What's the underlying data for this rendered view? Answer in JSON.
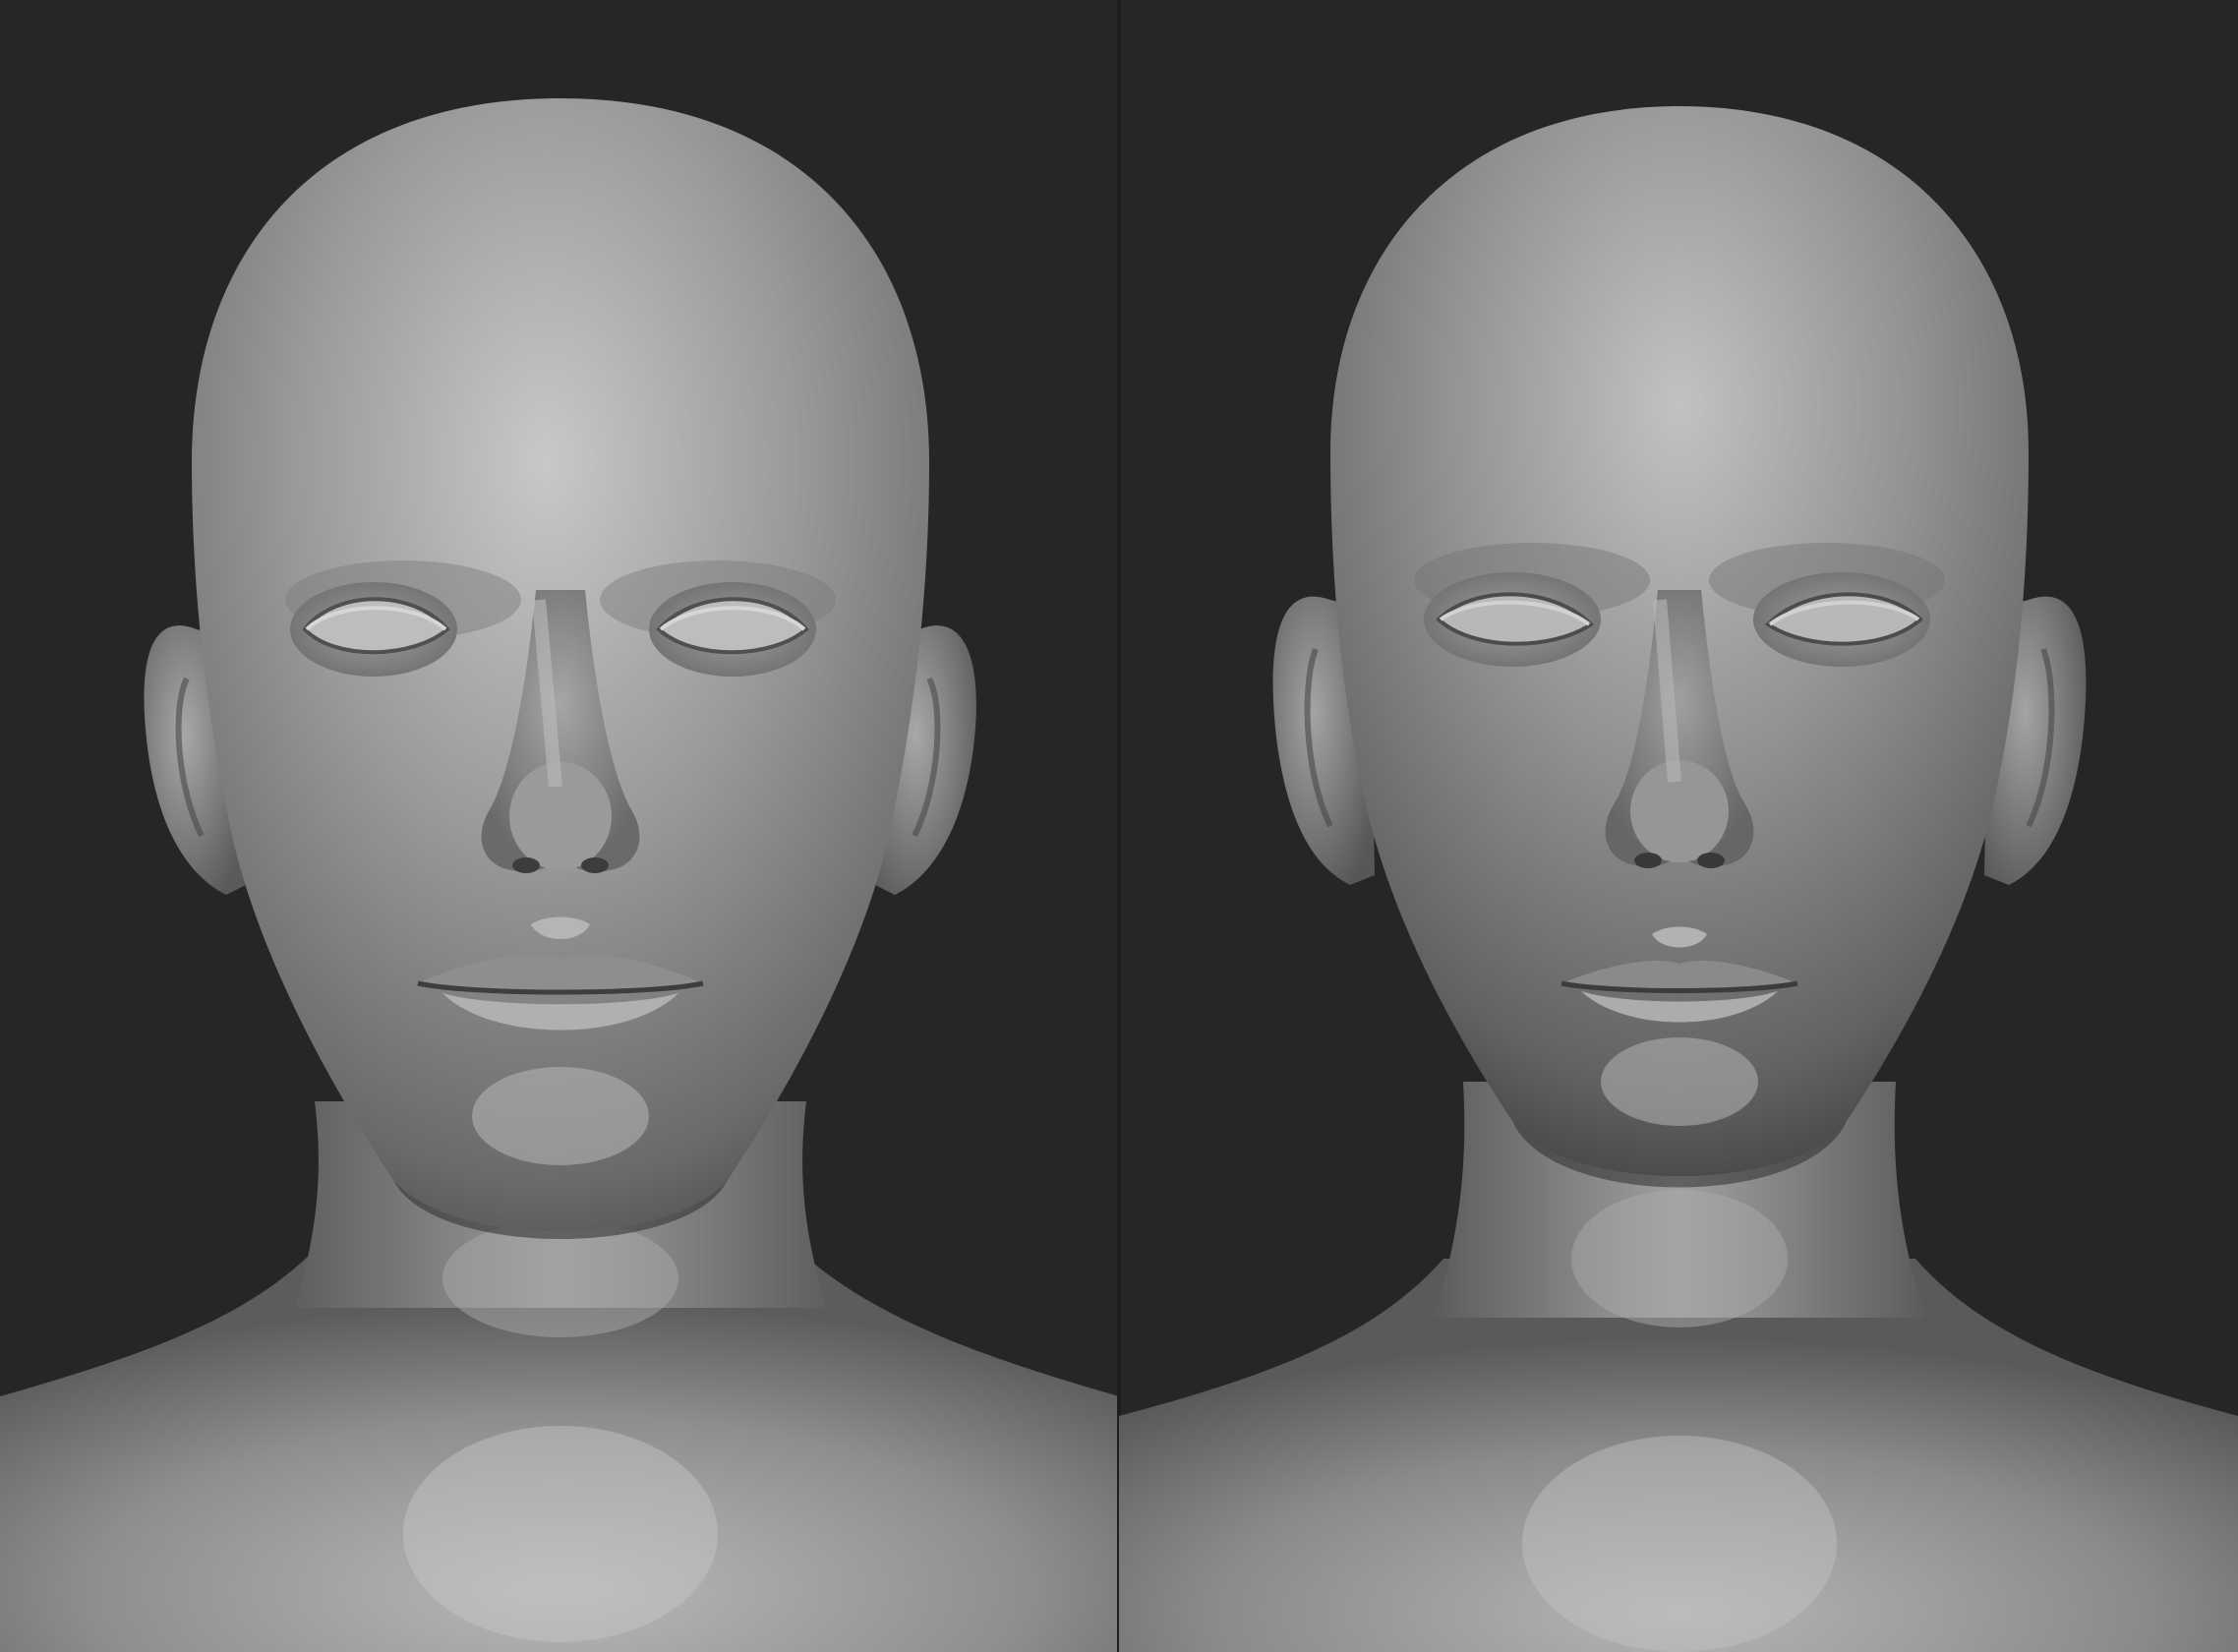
{
  "image": {
    "background_color": "#262626",
    "sculpt_base_color": "#8a8a8a",
    "highlight_color": "#c6c6c6",
    "shadow_color": "#3a3a3a"
  },
  "panels": [
    {
      "subject": "bald-male-head-sculpt-front-view"
    },
    {
      "subject": "bald-male-head-sculpt-front-view-refined"
    }
  ]
}
